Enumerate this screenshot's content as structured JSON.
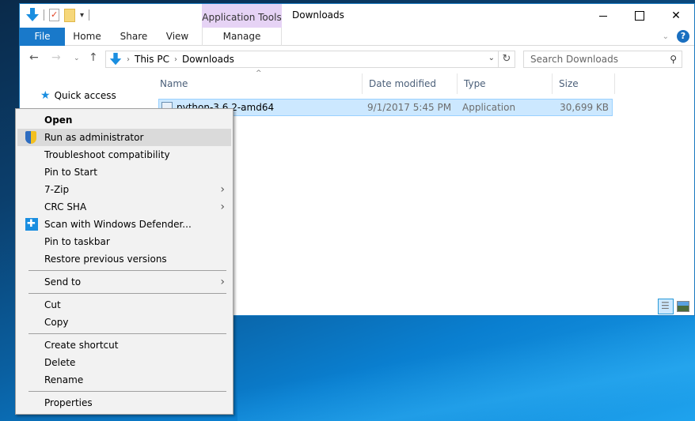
{
  "window": {
    "title": "Downloads",
    "contextual_tab_group": "Application Tools",
    "controls": {
      "minimize": "minimize",
      "maximize": "maximize",
      "close": "✕"
    }
  },
  "ribbon": {
    "tabs": [
      {
        "label": "File"
      },
      {
        "label": "Home"
      },
      {
        "label": "Share"
      },
      {
        "label": "View"
      },
      {
        "label": "Manage"
      }
    ],
    "help": "?",
    "expand": "⌄"
  },
  "navigation": {
    "back": "←",
    "forward": "→",
    "recent": "⌄",
    "up": "↑",
    "breadcrumb": [
      "This PC",
      "Downloads"
    ],
    "crumb_separator": "›",
    "address_dropdown": "⌄",
    "refresh": "↻",
    "search_placeholder": "Search Downloads",
    "search_glyph": "⚲"
  },
  "nav_pane": {
    "items": [
      {
        "label": "Quick access",
        "icon": "star-icon"
      }
    ]
  },
  "file_list": {
    "columns": [
      "Name",
      "Date modified",
      "Type",
      "Size"
    ],
    "sort_indicator": "^",
    "rows": [
      {
        "name": "python-3.6.2-amd64",
        "date_modified": "9/1/2017 5:45 PM",
        "type": "Application",
        "size": "30,699 KB",
        "selected": true
      }
    ]
  },
  "context_menu": {
    "items": [
      {
        "label": "Open",
        "bold": true
      },
      {
        "label": "Run as administrator",
        "icon": "uac-shield-icon",
        "hover": true
      },
      {
        "label": "Troubleshoot compatibility"
      },
      {
        "label": "Pin to Start"
      },
      {
        "label": "7-Zip",
        "submenu": true
      },
      {
        "label": "CRC SHA",
        "submenu": true
      },
      {
        "label": "Scan with Windows Defender...",
        "icon": "windows-defender-icon"
      },
      {
        "label": "Pin to taskbar"
      },
      {
        "label": "Restore previous versions"
      },
      {
        "label": "Send to",
        "submenu": true
      },
      {
        "label": "Cut"
      },
      {
        "label": "Copy"
      },
      {
        "label": "Create shortcut"
      },
      {
        "label": "Delete"
      },
      {
        "label": "Rename"
      },
      {
        "label": "Properties"
      }
    ],
    "submenu_glyph": "›"
  },
  "colors": {
    "file_tab": "#1979ca",
    "app_tools_tab": "#e6d3f5",
    "selection": "#cce8ff",
    "selection_border": "#99d1ff",
    "menu_bg": "#f2f2f2",
    "menu_hover": "#dadada"
  }
}
